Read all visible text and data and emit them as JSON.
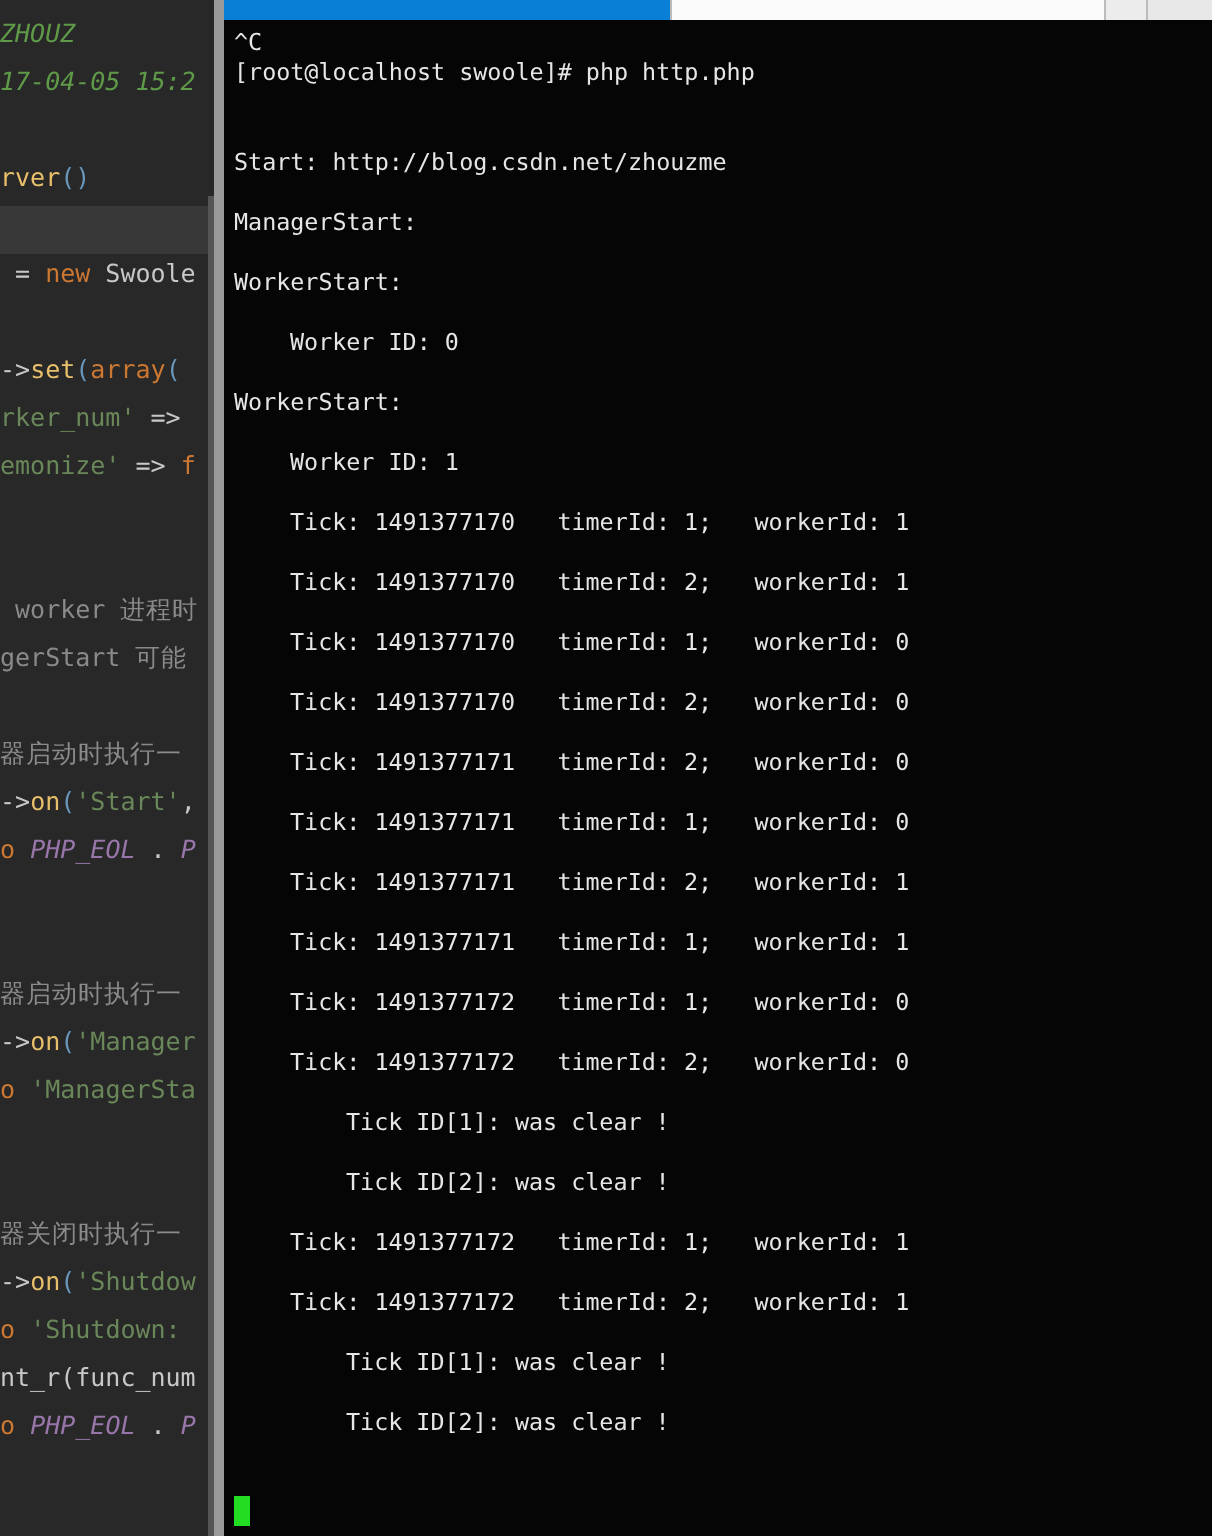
{
  "editor": {
    "lines": [
      {
        "kind": "code",
        "tokens": [
          {
            "text": "ZHOUZ",
            "kind": "doc"
          }
        ]
      },
      {
        "kind": "code",
        "tokens": [
          {
            "text": "17-04-05 15:2",
            "kind": "doc"
          }
        ]
      },
      {
        "kind": "blank"
      },
      {
        "kind": "code",
        "tokens": [
          {
            "text": "rver",
            "kind": "func"
          },
          {
            "text": "()",
            "kind": "paren"
          }
        ]
      },
      {
        "kind": "current"
      },
      {
        "kind": "code",
        "tokens": [
          {
            "text": " = ",
            "kind": "plain"
          },
          {
            "text": "new",
            "kind": "keyword"
          },
          {
            "text": " Swoole",
            "kind": "plain"
          }
        ]
      },
      {
        "kind": "blank"
      },
      {
        "kind": "code",
        "tokens": [
          {
            "text": "->",
            "kind": "plain"
          },
          {
            "text": "set",
            "kind": "func"
          },
          {
            "text": "(",
            "kind": "paren"
          },
          {
            "text": "array",
            "kind": "keyword"
          },
          {
            "text": "(",
            "kind": "paren"
          }
        ]
      },
      {
        "kind": "code",
        "tokens": [
          {
            "text": "rker_num'",
            "kind": "string"
          },
          {
            "text": " =>",
            "kind": "plain"
          }
        ]
      },
      {
        "kind": "code",
        "tokens": [
          {
            "text": "emonize'",
            "kind": "string"
          },
          {
            "text": " => ",
            "kind": "plain"
          },
          {
            "text": "f",
            "kind": "keyword"
          }
        ]
      },
      {
        "kind": "blank"
      },
      {
        "kind": "blank"
      },
      {
        "kind": "code",
        "tokens": [
          {
            "text": " worker 进程时",
            "kind": "comment"
          }
        ]
      },
      {
        "kind": "code",
        "tokens": [
          {
            "text": "gerStart 可能",
            "kind": "comment"
          }
        ]
      },
      {
        "kind": "blank"
      },
      {
        "kind": "code",
        "tokens": [
          {
            "text": "器启动时执行一",
            "kind": "comment"
          }
        ]
      },
      {
        "kind": "code",
        "tokens": [
          {
            "text": "->",
            "kind": "plain"
          },
          {
            "text": "on",
            "kind": "func"
          },
          {
            "text": "(",
            "kind": "paren"
          },
          {
            "text": "'Start'",
            "kind": "string"
          },
          {
            "text": ",",
            "kind": "plain"
          }
        ]
      },
      {
        "kind": "code",
        "tokens": [
          {
            "text": "o ",
            "kind": "keyword"
          },
          {
            "text": "PHP_EOL",
            "kind": "constant"
          },
          {
            "text": " . ",
            "kind": "plain"
          },
          {
            "text": "P",
            "kind": "constant"
          }
        ]
      },
      {
        "kind": "blank"
      },
      {
        "kind": "blank"
      },
      {
        "kind": "code",
        "tokens": [
          {
            "text": "器启动时执行一",
            "kind": "comment"
          }
        ]
      },
      {
        "kind": "code",
        "tokens": [
          {
            "text": "->",
            "kind": "plain"
          },
          {
            "text": "on",
            "kind": "func"
          },
          {
            "text": "(",
            "kind": "paren"
          },
          {
            "text": "'Manager",
            "kind": "string"
          }
        ]
      },
      {
        "kind": "code",
        "tokens": [
          {
            "text": "o ",
            "kind": "keyword"
          },
          {
            "text": "'ManagerSta",
            "kind": "string"
          }
        ]
      },
      {
        "kind": "blank"
      },
      {
        "kind": "blank"
      },
      {
        "kind": "code",
        "tokens": [
          {
            "text": "器关闭时执行一",
            "kind": "comment"
          }
        ]
      },
      {
        "kind": "code",
        "tokens": [
          {
            "text": "->",
            "kind": "plain"
          },
          {
            "text": "on",
            "kind": "func"
          },
          {
            "text": "(",
            "kind": "paren"
          },
          {
            "text": "'Shutdow",
            "kind": "string"
          }
        ]
      },
      {
        "kind": "code",
        "tokens": [
          {
            "text": "o ",
            "kind": "keyword"
          },
          {
            "text": "'Shutdown:",
            "kind": "string"
          }
        ]
      },
      {
        "kind": "code",
        "tokens": [
          {
            "text": "nt_r(func_num",
            "kind": "plain"
          }
        ]
      },
      {
        "kind": "code",
        "tokens": [
          {
            "text": "o ",
            "kind": "keyword"
          },
          {
            "text": "PHP_EOL",
            "kind": "constant"
          },
          {
            "text": " . ",
            "kind": "plain"
          },
          {
            "text": "P",
            "kind": "constant"
          }
        ]
      }
    ]
  },
  "terminal": {
    "lines": [
      {
        "kind": "echo",
        "text": "^C"
      },
      {
        "kind": "echo",
        "text": "[root@localhost swoole]# php http.php"
      },
      {
        "kind": "gap",
        "text": "Start: http://blog.csdn.net/zhouzme"
      },
      {
        "kind": "output",
        "text": "ManagerStart:"
      },
      {
        "kind": "output",
        "text": "WorkerStart:"
      },
      {
        "kind": "detail",
        "text": "Worker ID: 0"
      },
      {
        "kind": "output",
        "text": "WorkerStart:"
      },
      {
        "kind": "detail",
        "text": "Worker ID: 1"
      },
      {
        "kind": "detail",
        "text": "Tick: 1491377170   timerId: 1;   workerId: 1"
      },
      {
        "kind": "detail",
        "text": "Tick: 1491377170   timerId: 2;   workerId: 1"
      },
      {
        "kind": "detail",
        "text": "Tick: 1491377170   timerId: 1;   workerId: 0"
      },
      {
        "kind": "detail",
        "text": "Tick: 1491377170   timerId: 2;   workerId: 0"
      },
      {
        "kind": "detail",
        "text": "Tick: 1491377171   timerId: 2;   workerId: 0"
      },
      {
        "kind": "detail",
        "text": "Tick: 1491377171   timerId: 1;   workerId: 0"
      },
      {
        "kind": "detail",
        "text": "Tick: 1491377171   timerId: 2;   workerId: 1"
      },
      {
        "kind": "detail",
        "text": "Tick: 1491377171   timerId: 1;   workerId: 1"
      },
      {
        "kind": "detail",
        "text": "Tick: 1491377172   timerId: 1;   workerId: 0"
      },
      {
        "kind": "detail",
        "text": "Tick: 1491377172   timerId: 2;   workerId: 0"
      },
      {
        "kind": "nested",
        "text": "Tick ID[1]: was clear !"
      },
      {
        "kind": "nested",
        "text": "Tick ID[2]: was clear !"
      },
      {
        "kind": "detail",
        "text": "Tick: 1491377172   timerId: 1;   workerId: 1"
      },
      {
        "kind": "detail",
        "text": "Tick: 1491377172   timerId: 2;   workerId: 1"
      },
      {
        "kind": "nested",
        "text": "Tick ID[1]: was clear !"
      },
      {
        "kind": "nested",
        "text": "Tick ID[2]: was clear !"
      }
    ]
  }
}
